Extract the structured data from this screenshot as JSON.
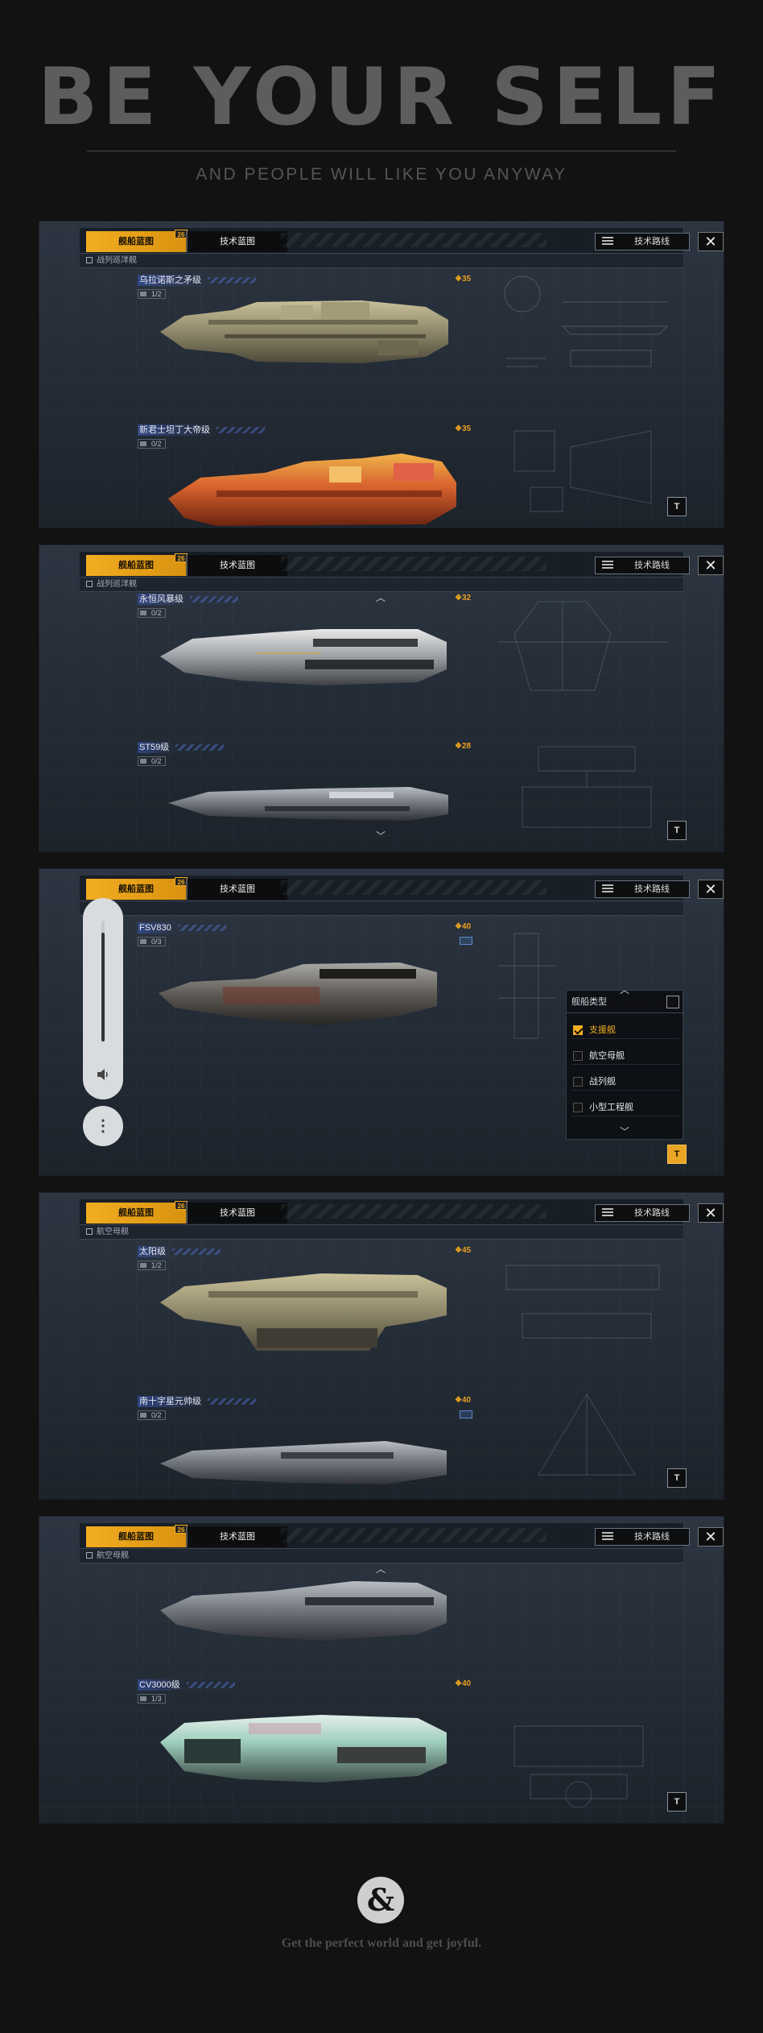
{
  "hero": {
    "title": "BE YOUR SELF",
    "subtitle": "AND PEOPLE WILL LIKE YOU ANYWAY"
  },
  "tabs": {
    "blueprint": "舰船蓝图",
    "badge": "26",
    "tech_blueprint": "技术蓝图",
    "tech_route": "技术路线",
    "close": "✕"
  },
  "text_button": "T",
  "colors": {
    "accent": "#f1ad22",
    "cost": "#e8a020",
    "name_highlight": "#3750a0"
  },
  "panels": [
    {
      "category": "战列巡洋舰",
      "ships": [
        {
          "name": "乌拉诺斯之矛级",
          "tag": "1/2",
          "cost": "35"
        },
        {
          "name": "新君士坦丁大帝级",
          "tag": "0/2",
          "cost": "35"
        }
      ]
    },
    {
      "category": "战列巡洋舰",
      "ships": [
        {
          "name": "永恒风暴级",
          "tag": "0/2",
          "cost": "32"
        },
        {
          "name": "ST59级",
          "tag": "0/2",
          "cost": "28"
        }
      ]
    },
    {
      "category": "",
      "ships": [
        {
          "name": "FSV830",
          "tag": "0/3",
          "cost": "40"
        }
      ],
      "volume": {
        "level": 0.9
      },
      "more_label": "⋮",
      "filter": {
        "title": "舰船类型",
        "items": [
          {
            "label": "支援舰",
            "checked": true
          },
          {
            "label": "航空母舰",
            "checked": false
          },
          {
            "label": "战列舰",
            "checked": false
          },
          {
            "label": "小型工程舰",
            "checked": false
          }
        ]
      }
    },
    {
      "category": "航空母舰",
      "ships": [
        {
          "name": "太阳级",
          "tag": "1/2",
          "cost": "45"
        },
        {
          "name": "南十字星元帅级",
          "tag": "0/2",
          "cost": "40"
        }
      ]
    },
    {
      "category": "航空母舰",
      "ships": [
        {
          "name": "CV3000级",
          "tag": "1/3",
          "cost": "40"
        }
      ]
    }
  ],
  "footer": {
    "symbol": "&",
    "tagline": "Get the perfect world and get joyful."
  }
}
